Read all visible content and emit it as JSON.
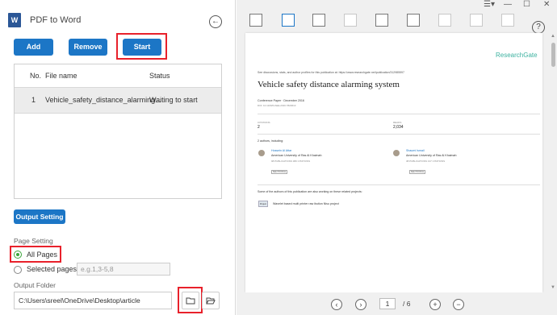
{
  "app": {
    "logo_letter": "W",
    "title": "PDF to Word",
    "back_icon": "back-arrow-icon"
  },
  "toolbar": {
    "add_label": "Add",
    "remove_label": "Remove",
    "start_label": "Start"
  },
  "file_table": {
    "columns": [
      "No.",
      "File name",
      "Status"
    ],
    "rows": [
      {
        "no": "1",
        "file_name": "Vehicle_safety_distance_alarming...",
        "status": "Waiting to start"
      }
    ]
  },
  "output_setting_label": "Output Setting",
  "page_setting": {
    "label": "Page Setting",
    "all_pages_label": "All Pages",
    "selected_pages_label": "Selected pages",
    "range_placeholder": "e.g.1,3-5,8",
    "selected": "All Pages"
  },
  "output_folder": {
    "label": "Output Folder",
    "path": "C:\\Users\\sreel\\OneDrive\\Desktop\\article",
    "browse_icon": "folder-icon",
    "open_icon": "open-folder-icon"
  },
  "window_controls": {
    "menu": "☰▾",
    "minimize": "—",
    "maximize": "☐",
    "close": "✕"
  },
  "viewer": {
    "help_label": "?",
    "page_current": "1",
    "page_total": "/ 6",
    "nav_prev": "‹",
    "nav_next": "›",
    "zoom_in": "+",
    "zoom_out": "−"
  },
  "document": {
    "brand": "ResearchGate",
    "intro": "See discussions, stats, and author profiles for this publication at: https://www.researchgate.net/publication/312985597",
    "title": "Vehicle safety distance alarming system",
    "type_line": "Conference Paper · December 2016",
    "doi_line": "DOI: 10.1109/ICAEE.2016.7820613",
    "citations_label": "CITATIONS",
    "citations_value": "2",
    "reads_label": "READS",
    "reads_value": "2,034",
    "authors_heading": "2 authors, including:",
    "author1_name": "Hossein Al Attar",
    "author1_aff": "American University of Ras Al Khaimah",
    "author1_stats": "98 PUBLICATIONS   380 CITATIONS",
    "author2_name": "Shaumi Ismail",
    "author2_aff": "American University of Ras Al Khaimah",
    "author2_stats": "38 PUBLICATIONS   137 CITATIONS",
    "see_profile": "SEE PROFILE",
    "projects_heading": "Some of the authors of this publication are also working on these related projects:",
    "project_thumb": "Project",
    "project_text": "Wavelet based multi printer raw ibution Nisu project"
  }
}
